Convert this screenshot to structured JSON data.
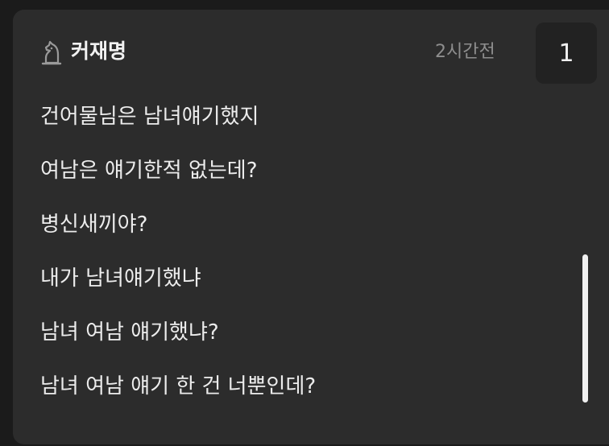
{
  "comment": {
    "username": "커재명",
    "user_icon": "chess-knight-icon",
    "timestamp": "2시간전",
    "count": "1",
    "lines": [
      "건어물님은 남녀얘기했지",
      "여남은 얘기한적 없는데?",
      "병신새끼야?",
      "내가 남녀얘기했냐",
      "남녀 여남 얘기했냐?",
      "남녀 여남 얘기 한 건 너뿐인데?"
    ]
  },
  "colors": {
    "page_background": "#1b1b1b",
    "card_background": "#2c2c2c",
    "badge_background": "#222222",
    "text_primary": "#ececec",
    "text_muted": "#8e8e8e",
    "scrollbar": "#f0f0f0"
  }
}
